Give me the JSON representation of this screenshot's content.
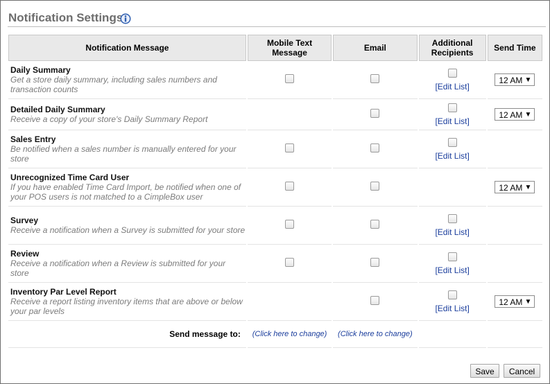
{
  "page": {
    "title": "Notification Settings",
    "info_icon": "info-icon"
  },
  "table": {
    "headers": {
      "message": "Notification Message",
      "mobile": "Mobile Text Message",
      "email": "Email",
      "recipients": "Additional Recipients",
      "send_time": "Send Time"
    },
    "rows": [
      {
        "title": "Daily Summary",
        "desc": "Get a store daily summary, including sales numbers and transaction counts",
        "mobile": true,
        "email": true,
        "recipients": true,
        "edit": "[Edit List]",
        "time": "12 AM"
      },
      {
        "title": "Detailed Daily Summary",
        "desc": "Receive a copy of your store's Daily Summary Report",
        "mobile": false,
        "email": true,
        "recipients": true,
        "edit": "[Edit List]",
        "time": "12 AM"
      },
      {
        "title": "Sales Entry",
        "desc": "Be notified when a sales number is manually entered for your store",
        "mobile": true,
        "email": true,
        "recipients": true,
        "edit": "[Edit List]",
        "time": ""
      },
      {
        "title": "Unrecognized Time Card User",
        "desc": "If you have enabled Time Card Import, be notified when one of your POS users is not matched to a CimpleBox user",
        "mobile": true,
        "email": true,
        "recipients": false,
        "edit": "",
        "time": "12 AM"
      },
      {
        "title": "Survey",
        "desc": "Receive a notification when a Survey is submitted for your store",
        "mobile": true,
        "email": true,
        "recipients": true,
        "edit": "[Edit List]",
        "time": ""
      },
      {
        "title": "Review",
        "desc": "Receive a notification when a Review is submitted for your store",
        "mobile": true,
        "email": true,
        "recipients": true,
        "edit": "[Edit List]",
        "time": ""
      },
      {
        "title": "Inventory Par Level Report",
        "desc": "Receive a report listing inventory items that are above or below your par levels",
        "mobile": false,
        "email": true,
        "recipients": true,
        "edit": "[Edit List]",
        "time": "12 AM"
      }
    ],
    "send_to": {
      "label": "Send message to:",
      "mobile_link": "(Click here to change)",
      "email_link": "(Click here to change)"
    }
  },
  "buttons": {
    "save": "Save",
    "cancel": "Cancel"
  },
  "colors": {
    "title": "#6e6e6e",
    "header_bg": "#e9e9e9",
    "link": "#1a3d9c",
    "desc": "#7b7b7b"
  }
}
